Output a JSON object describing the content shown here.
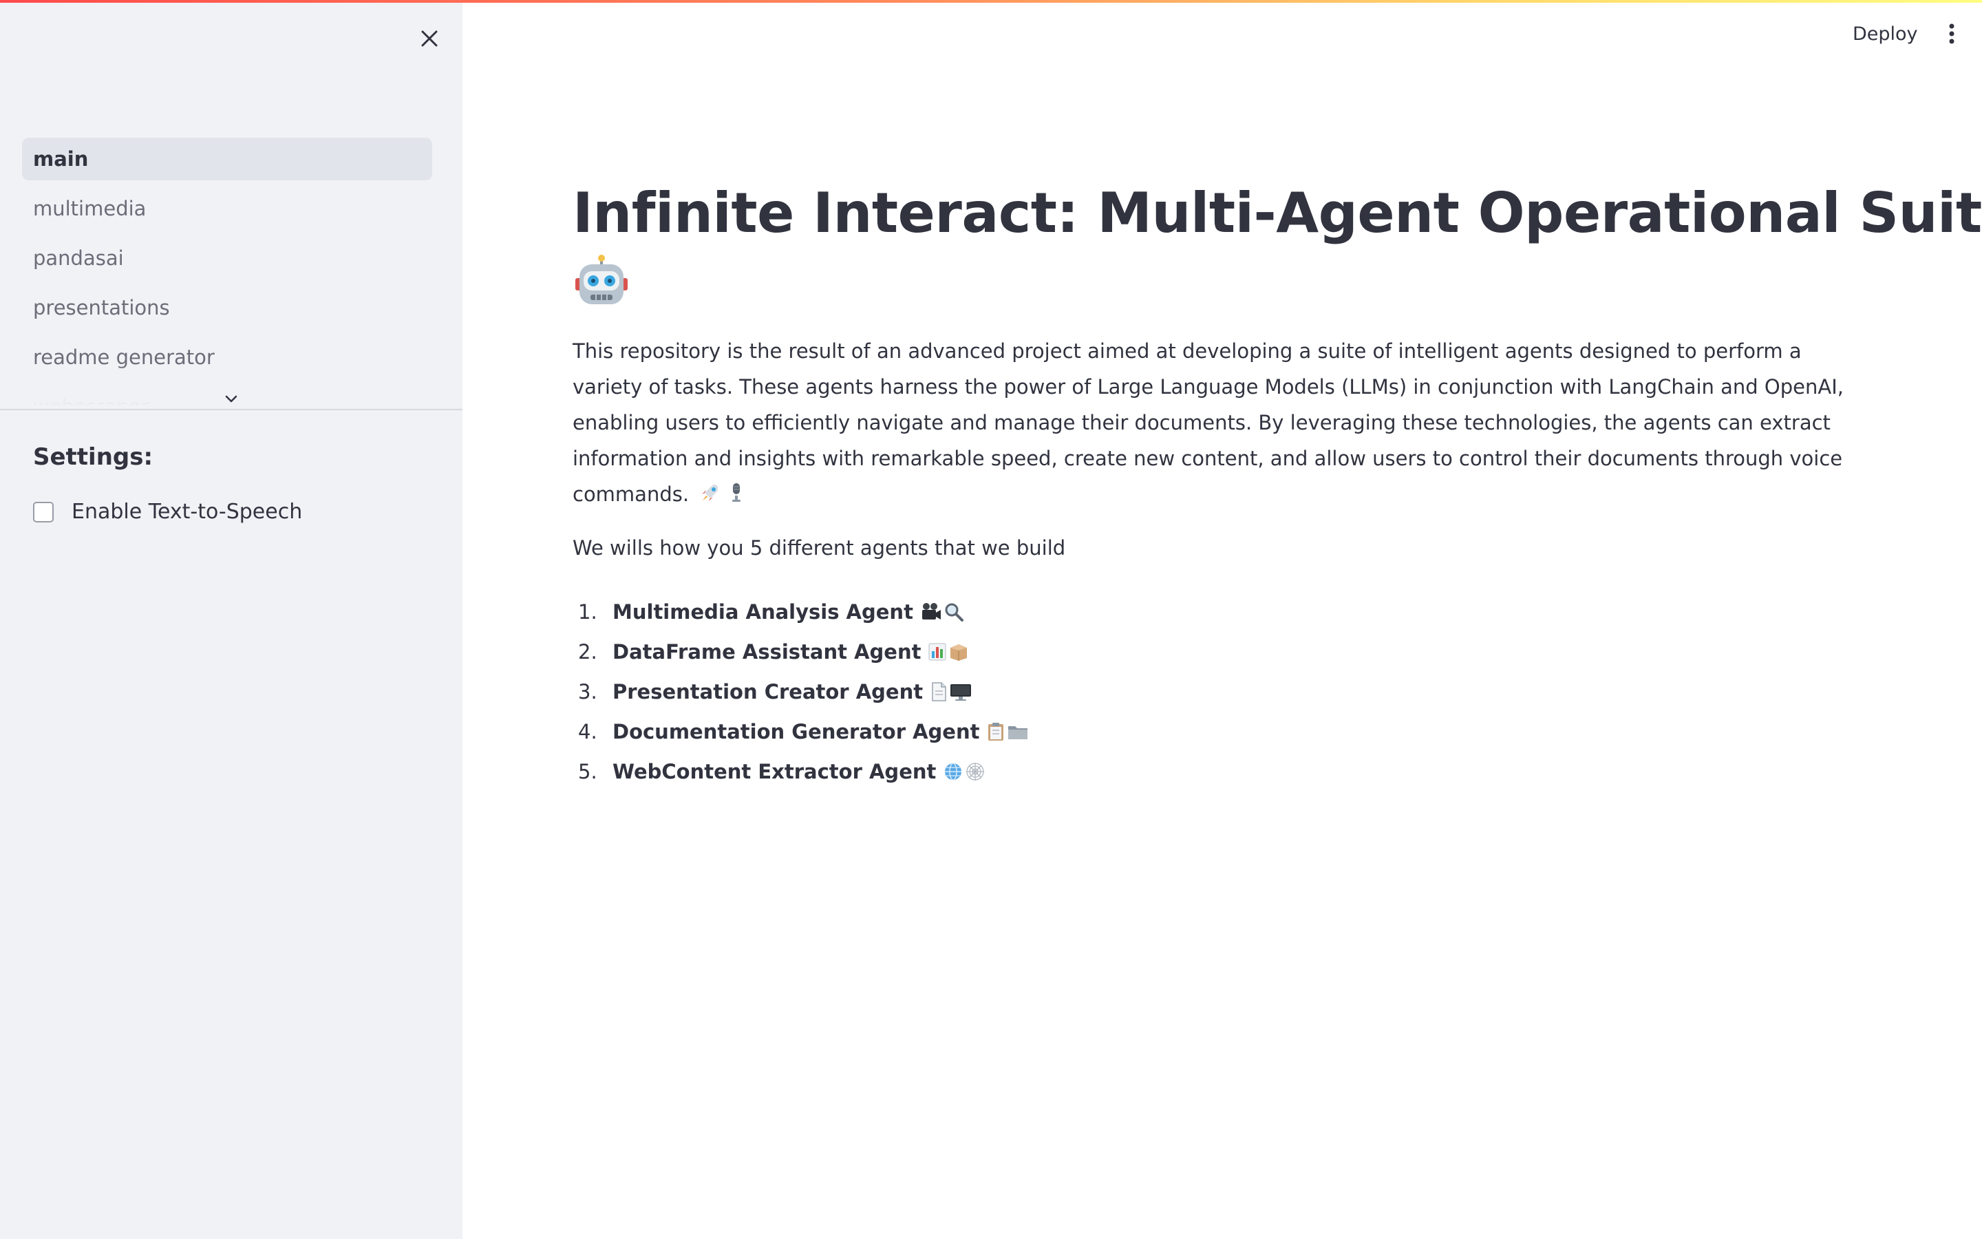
{
  "header": {
    "deploy_label": "Deploy"
  },
  "sidebar": {
    "nav_items": [
      {
        "label": "main",
        "active": true
      },
      {
        "label": "multimedia",
        "active": false
      },
      {
        "label": "pandasai",
        "active": false
      },
      {
        "label": "presentations",
        "active": false
      },
      {
        "label": "readme generator",
        "active": false
      },
      {
        "label": "webscraper",
        "active": false
      }
    ],
    "settings_title": "Settings:",
    "tts_label": "Enable Text-to-Speech",
    "tts_checked": false
  },
  "main": {
    "title": "Infinite Interact: Multi-Agent Operational Suite",
    "intro": "This repository is the result of an advanced project aimed at developing a suite of intelligent agents designed to perform a variety of tasks. These agents harness the power of Large Language Models (LLMs) in conjunction with LangChain and OpenAI, enabling users to efficiently navigate and manage their documents. By leveraging these technologies, the agents can extract information and insights with remarkable speed, create new content, and allow users to control their documents through voice commands.",
    "subtitle": "We wills how you 5 different agents that we build",
    "agents": [
      {
        "num": "1.",
        "name": "Multimedia Analysis Agent",
        "icons": [
          "film-camera-icon",
          "magnifier-icon"
        ]
      },
      {
        "num": "2.",
        "name": "DataFrame Assistant Agent",
        "icons": [
          "bar-chart-icon",
          "package-icon"
        ]
      },
      {
        "num": "3.",
        "name": "Presentation Creator Agent",
        "icons": [
          "document-icon",
          "monitor-icon"
        ]
      },
      {
        "num": "4.",
        "name": "Documentation Generator Agent",
        "icons": [
          "clipboard-icon",
          "folder-icon"
        ]
      },
      {
        "num": "5.",
        "name": "WebContent Extractor Agent",
        "icons": [
          "globe-icon",
          "web-icon"
        ]
      }
    ]
  },
  "colors": {
    "sidebar_bg": "#f0f2f6",
    "active_nav_bg": "#e1e4ea",
    "text": "#31333f",
    "muted_text": "#6b6d78",
    "accent_start": "#ff4b4b",
    "accent_end": "#fffd80"
  }
}
